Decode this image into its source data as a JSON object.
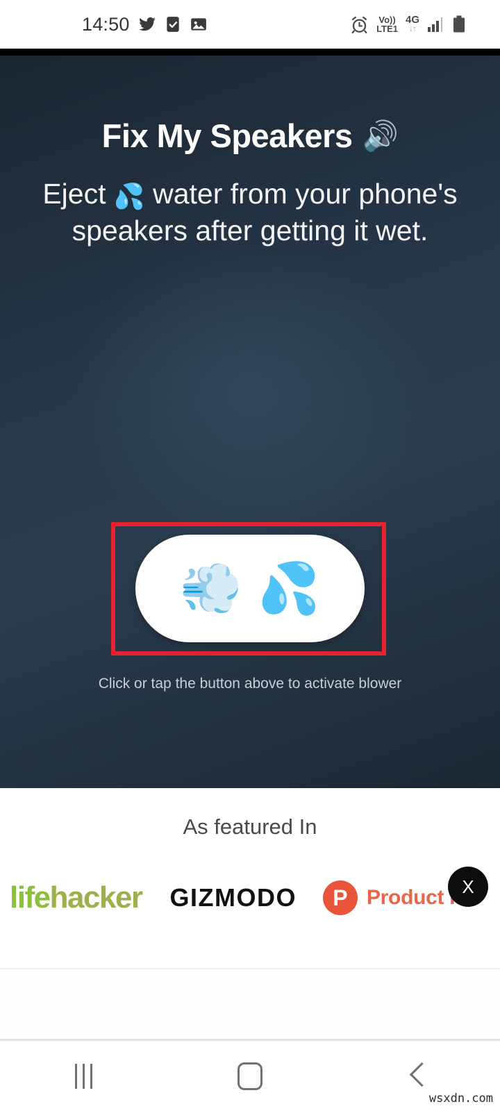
{
  "status_bar": {
    "time": "14:50",
    "left_icons": [
      "twitter-icon",
      "checkbox-icon",
      "image-icon"
    ],
    "alarm_icon": "alarm-icon",
    "volte_line1": "Vo))",
    "volte_line2": "LTE1",
    "network_type": "4G",
    "data_arrows": "↓↑",
    "signal_icon": "signal-bars-icon",
    "battery_icon": "battery-icon"
  },
  "hero": {
    "title": "Fix My Speakers",
    "title_emoji": "🔊",
    "subtitle_part1": "Eject",
    "subtitle_emoji": "💦",
    "subtitle_part2": "water from your phone's speakers after getting it wet.",
    "button": {
      "blower_emoji": "💨",
      "water_emoji": "💦",
      "highlight_color": "#e8232f"
    },
    "hint": "Click or tap the button above to activate blower",
    "background_color": "#27384a"
  },
  "featured": {
    "title": "As featured In",
    "logos": [
      {
        "name": "lifehacker",
        "part1": "life",
        "part2": "hacker",
        "color1": "#8cbe3f",
        "color2": "#9cb04c"
      },
      {
        "name": "GIZMODO",
        "color": "#121212"
      },
      {
        "name": "Product Hunt",
        "badge": "P",
        "text": "Product H",
        "color": "#e8553a"
      }
    ]
  },
  "close_button": {
    "label": "X"
  },
  "nav_bar": {
    "recents_label": "recents-button",
    "home_label": "home-button",
    "back_label": "back-button"
  },
  "watermark": "wsxdn.com"
}
